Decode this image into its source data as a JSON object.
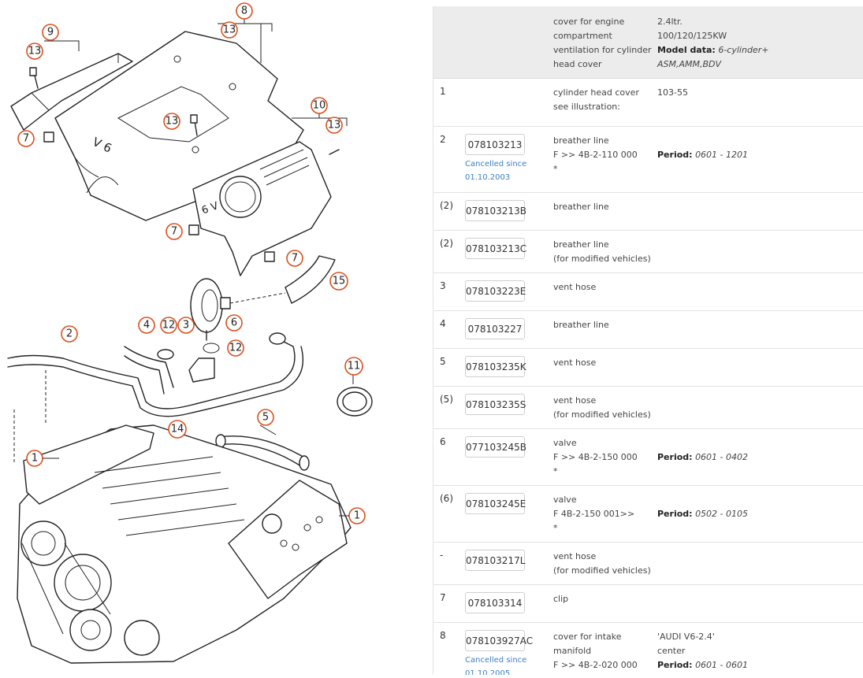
{
  "header": {
    "desc": "cover for engine\ncompartment\nventilation for cylinder\nhead cover",
    "info_plain": "2.4ltr.\n100/120/125KW",
    "info_label": "Model data:",
    "info_value": "6-cylinder+",
    "info_value2": "ASM,AMM,BDV"
  },
  "period_label": "Period:",
  "rows": [
    {
      "pos": "1",
      "part": "",
      "cancel": "",
      "desc": "cylinder head cover\nsee illustration:",
      "info": "103-55",
      "period": ""
    },
    {
      "pos": "2",
      "part": "078103213",
      "cancel": "Cancelled since\n01.10.2003",
      "desc": "breather line\nF >> 4B-2-110 000\n*",
      "info": "",
      "period": "0601 - 1201"
    },
    {
      "pos": "(2)",
      "part": "078103213B",
      "cancel": "",
      "desc": "breather line",
      "info": "",
      "period": ""
    },
    {
      "pos": "(2)",
      "part": "078103213C",
      "cancel": "",
      "desc": "breather line\n(for modified vehicles)",
      "info": "",
      "period": ""
    },
    {
      "pos": "3",
      "part": "078103223E",
      "cancel": "",
      "desc": "vent hose",
      "info": "",
      "period": ""
    },
    {
      "pos": "4",
      "part": "078103227",
      "cancel": "",
      "desc": "breather line",
      "info": "",
      "period": ""
    },
    {
      "pos": "5",
      "part": "078103235K",
      "cancel": "",
      "desc": "vent hose",
      "info": "",
      "period": ""
    },
    {
      "pos": "(5)",
      "part": "078103235S",
      "cancel": "",
      "desc": "vent hose\n(for modified vehicles)",
      "info": "",
      "period": ""
    },
    {
      "pos": "6",
      "part": "077103245B",
      "cancel": "",
      "desc": "valve\nF >> 4B-2-150 000\n*",
      "info": "",
      "period": "0601 - 0402"
    },
    {
      "pos": "(6)",
      "part": "078103245E",
      "cancel": "",
      "desc": "valve\nF 4B-2-150 001>>\n*",
      "info": "",
      "period": "0502 - 0105"
    },
    {
      "pos": "-",
      "part": "078103217L",
      "cancel": "",
      "desc": "vent hose\n(for modified vehicles)",
      "info": "",
      "period": ""
    },
    {
      "pos": "7",
      "part": "078103314",
      "cancel": "",
      "desc": "clip",
      "info": "",
      "period": ""
    },
    {
      "pos": "8",
      "part": "078103927AC",
      "cancel": "Cancelled since\n01.10.2005",
      "desc": "cover for intake\nmanifold\nF >> 4B-2-020 000\n*",
      "info": "'AUDI V6-2.4'\ncenter",
      "period": "0601 - 0601"
    }
  ],
  "callouts": [
    "9",
    "13",
    "8",
    "13",
    "13",
    "10",
    "13",
    "7",
    "7",
    "7",
    "15",
    "6",
    "4",
    "12",
    "3",
    "12",
    "2",
    "11",
    "5",
    "14",
    "1",
    "1"
  ],
  "diagram_labels": {
    "v6_a": "V 6",
    "v6_b": "6 V"
  }
}
